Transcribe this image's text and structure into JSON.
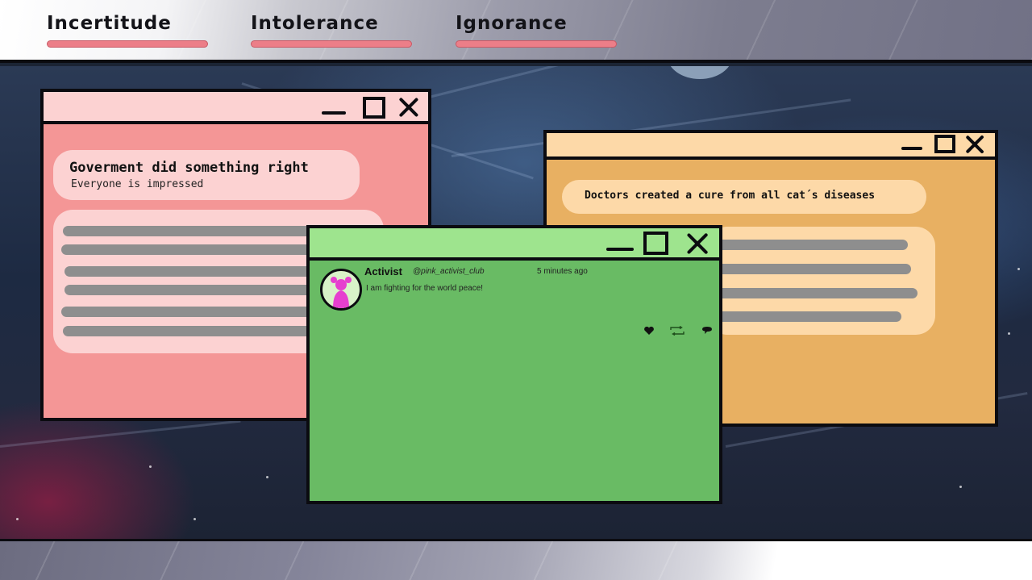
{
  "tabs": [
    {
      "label": "Incertitude"
    },
    {
      "label": "Intolerance"
    },
    {
      "label": "Ignorance"
    }
  ],
  "colors": {
    "tab_underline": "#ec7e88",
    "pink_window": "#f49696",
    "pink_titlebar": "#fcd2d2",
    "orange_window": "#e8b062",
    "orange_titlebar": "#fdd9a8",
    "green_window": "#69bb64",
    "green_titlebar": "#9ee48e",
    "avatar_figure": "#e63fcf"
  },
  "windows": {
    "pink": {
      "headline": "Goverment did something right",
      "subheadline": "Everyone is impressed"
    },
    "orange": {
      "headline": "Doctors created a cure from all cat´s diseases"
    },
    "green": {
      "post": {
        "name": "Activist",
        "handle": "@pink_activist_club",
        "time": "5 minutes ago",
        "text": "I am fighting for the world peace!",
        "actions": [
          "heart-icon",
          "repost-icon",
          "comment-icon"
        ]
      }
    }
  }
}
